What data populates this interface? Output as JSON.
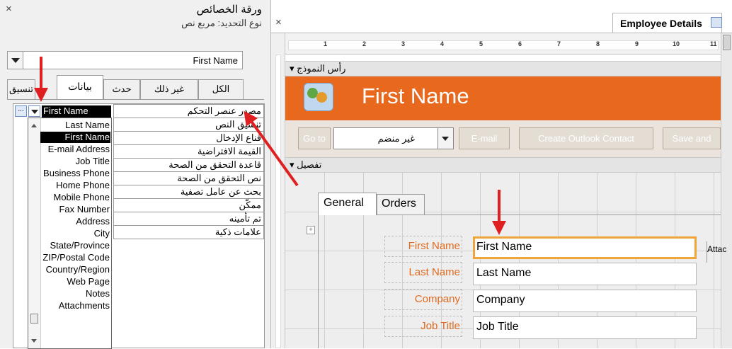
{
  "property_sheet": {
    "close": "×",
    "title": "ورقة الخصائص",
    "selection_type": "نوع التحديد:  مربع نص",
    "selected_object": "First Name",
    "tabs": [
      "تنسيق",
      "بيانات",
      "حدث",
      "غير ذلك",
      "الكل"
    ],
    "properties": [
      "مصدر عنصر التحكم",
      "تنسيق النص",
      "قناع الإدخال",
      "القيمة الافتراضية",
      "قاعدة التحقق من الصحة",
      "نص التحقق من الصحة",
      "بحث عن عامل تصفية",
      "ممكّن",
      "تم تأمينه",
      "علامات ذكية"
    ],
    "control_source_value": "First Name",
    "dropdown_button": "...",
    "field_list": [
      "Last Name",
      "First Name",
      "E-mail Address",
      "Job Title",
      "Business Phone",
      "Home Phone",
      "Mobile Phone",
      "Fax Number",
      "Address",
      "City",
      "State/Province",
      "ZIP/Postal Code",
      "Country/Region",
      "Web Page",
      "Notes",
      "Attachments"
    ],
    "highlighted_field": "First Name"
  },
  "designer": {
    "close": "×",
    "document_tab": "Employee Details",
    "ruler_numbers": [
      "1",
      "2",
      "3",
      "4",
      "5",
      "6",
      "7",
      "8",
      "9",
      "10",
      "11"
    ],
    "form_header_label": "رأس النموذج",
    "header_title": "First Name",
    "nav": {
      "goto_label": "Go to",
      "goto_value": "غير منضم",
      "email_button": "E-mail",
      "outlook_button": "Create Outlook Contact",
      "save_button": "Save and"
    },
    "detail_label": "تفصيل",
    "form_tabs": [
      "General",
      "Orders"
    ],
    "move_handle": "+",
    "fields": [
      {
        "label": "First Name",
        "value": "First Name"
      },
      {
        "label": "Last Name",
        "value": "Last Name"
      },
      {
        "label": "Company",
        "value": "Company"
      },
      {
        "label": "Job Title",
        "value": "Job Title"
      }
    ],
    "attachments_label": "Attac"
  },
  "colors": {
    "header_orange": "#e8681e",
    "label_orange": "#e06a1e",
    "selection_border": "#f0a43c",
    "annotation_arrow": "#e02020"
  }
}
